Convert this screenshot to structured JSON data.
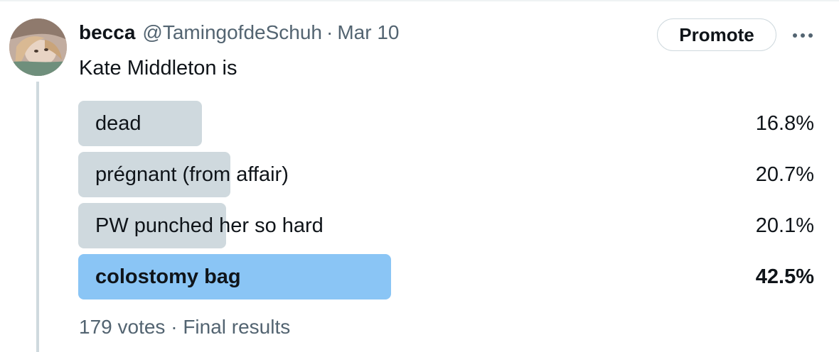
{
  "tweet": {
    "display_name": "becca",
    "handle": "@TamingofdeSchuh",
    "separator": "·",
    "date": "Mar 10",
    "text": "Kate Middleton is",
    "promote_label": "Promote",
    "more_icon": "more-horizontal-icon"
  },
  "poll": {
    "options": [
      {
        "label": "dead",
        "percent_text": "16.8%",
        "percent": 16.8,
        "winner": false
      },
      {
        "label": "prégnant (from affair)",
        "percent_text": "20.7%",
        "percent": 20.7,
        "winner": false
      },
      {
        "label": "PW punched her so hard",
        "percent_text": "20.1%",
        "percent": 20.1,
        "winner": false
      },
      {
        "label": "colostomy bag",
        "percent_text": "42.5%",
        "percent": 42.5,
        "winner": true
      }
    ],
    "votes": "179 votes",
    "separator": "·",
    "status": "Final results"
  },
  "colors": {
    "bar": "#cfd9de",
    "winner_bar": "#8ac5f5",
    "secondary_text": "#536471",
    "primary_text": "#0f1419"
  }
}
